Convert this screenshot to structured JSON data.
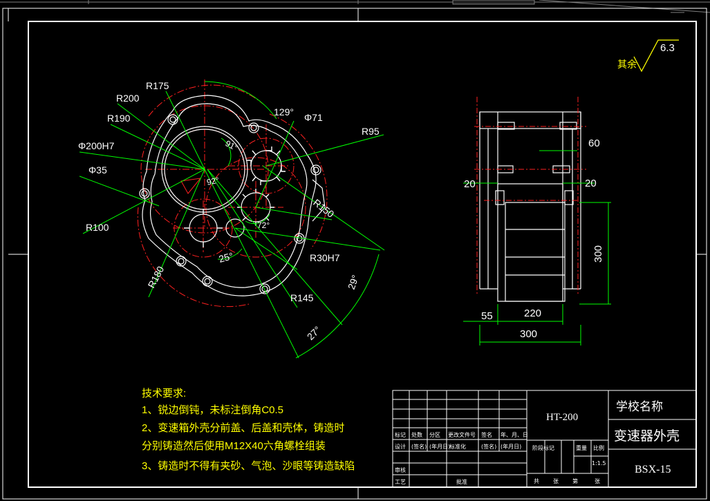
{
  "roughness": {
    "label": "其余",
    "value": "6.3"
  },
  "front_view": {
    "dims": {
      "r175": "R175",
      "r200": "R200",
      "r190": "R190",
      "d200h7": "Φ200H7",
      "d35": "Φ35",
      "r100": "R100",
      "r180": "R180",
      "a129": "129°",
      "d71": "Φ71",
      "r95": "R95",
      "a91": "91°",
      "a92": "92°",
      "r150": "R150",
      "a72": "72°",
      "a25": "25°",
      "r30h7": "R30H7",
      "r145": "R145",
      "a29": "29°",
      "a27": "27°"
    }
  },
  "side_view": {
    "dims": {
      "w60": "60",
      "w20_left": "20",
      "w20_right": "20",
      "h300": "300",
      "w55": "55",
      "w220": "220",
      "w300": "300"
    }
  },
  "notes": {
    "title": "技术要求:",
    "lines": [
      "1、锐边倒钝，未标注倒角C0.5",
      "2、变速箱外壳分前盖、后盖和壳体，铸造时",
      "分别铸造然后使用M12X40六角螺栓组装",
      "3、铸造时不得有夹砂、气泡、沙眼等铸造缺陷"
    ]
  },
  "title_block": {
    "material": "HT-200",
    "school": "学校名称",
    "part_name": "变速器外壳",
    "drawing_no": "BSX-15",
    "row_labels": [
      "标记",
      "处数",
      "分区",
      "更改文件号",
      "签名",
      "年、月、日"
    ],
    "design_row": [
      "设计",
      "(签名)",
      "(年月日)",
      "标准化",
      "(签名)",
      "(年月日)"
    ],
    "approve_label": "审核",
    "process_label": "工艺",
    "approve2_label": "批准",
    "stage_labels": [
      "阶段标记",
      "重量",
      "比例"
    ],
    "scale": "1:1.5",
    "sheet_labels": [
      "共",
      "张",
      "第",
      "张"
    ]
  },
  "colors": {
    "outline": "#ffffff",
    "center": "#ff2020",
    "dimension": "#00ff00",
    "accent": "#ffff00"
  }
}
